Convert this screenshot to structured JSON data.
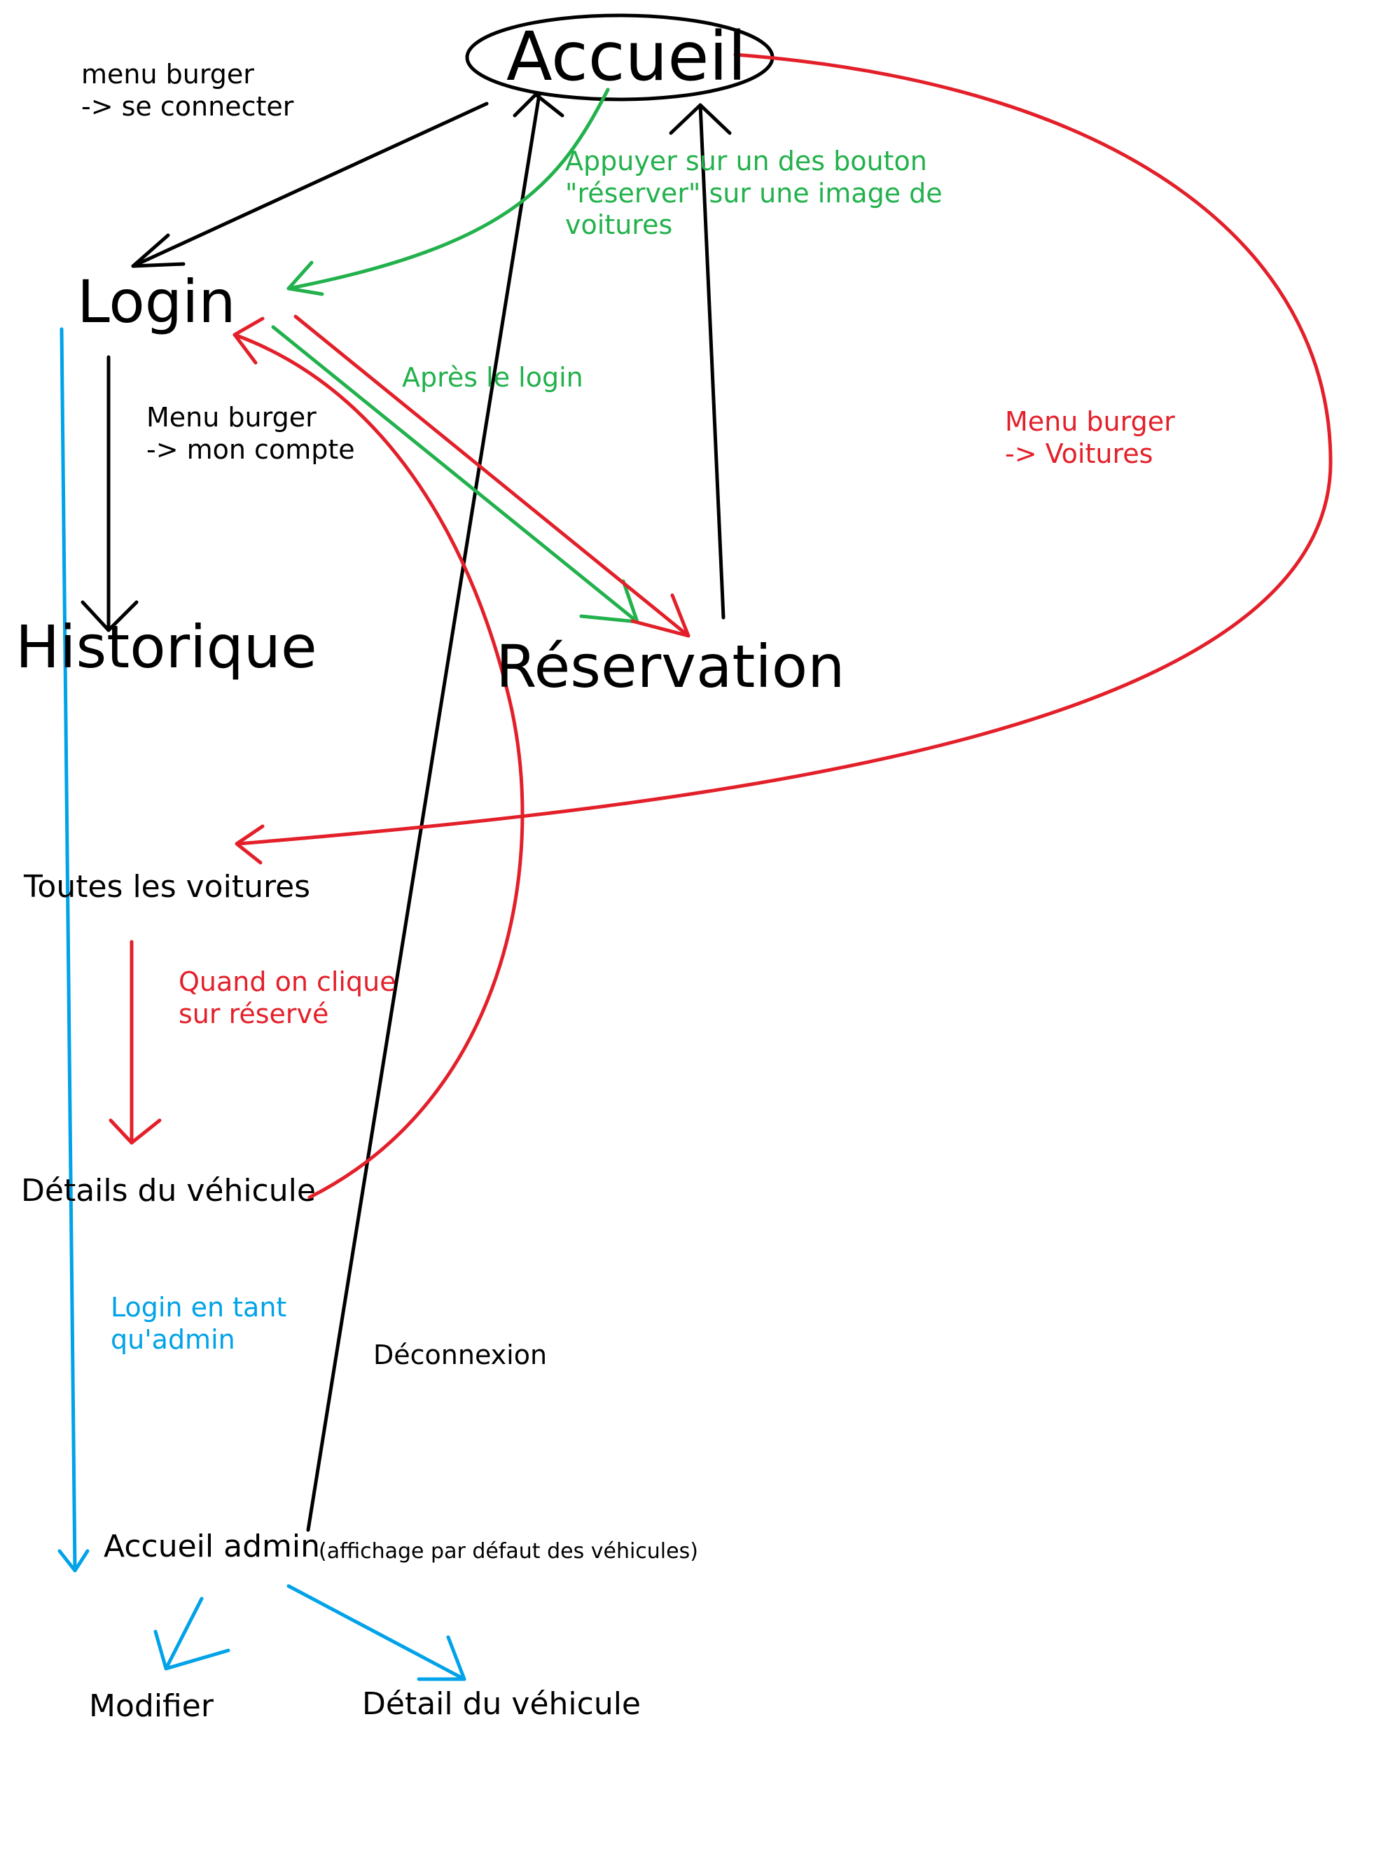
{
  "colors": {
    "black": "#000000",
    "red": "#e3202a",
    "green": "#22b14c",
    "blue": "#00a2e8"
  },
  "nodes": {
    "accueil": "Accueil",
    "login": "Login",
    "historique": "Historique",
    "reservation": "Réservation",
    "toutes_voitures": "Toutes les voitures",
    "details_vehicule": "Détails du véhicule",
    "accueil_admin": "Accueil admin",
    "accueil_admin_note": "(affichage par défaut des véhicules)",
    "modifier": "Modifier",
    "detail_vehicule": "Détail du véhicule"
  },
  "edges": {
    "menu_burger_connect": "menu burger\n-> se connecter",
    "appuyer_reserver": "Appuyer sur un des bouton\n\"réserver\" sur une image de\nvoitures",
    "apres_login": "Après le login",
    "menu_burger_compte": "Menu burger\n-> mon compte",
    "menu_burger_voitures": "Menu burger\n-> Voitures",
    "quand_clique": "Quand on clique\nsur réservé",
    "login_admin": "Login en tant\nqu'admin",
    "deconnexion": "Déconnexion"
  }
}
